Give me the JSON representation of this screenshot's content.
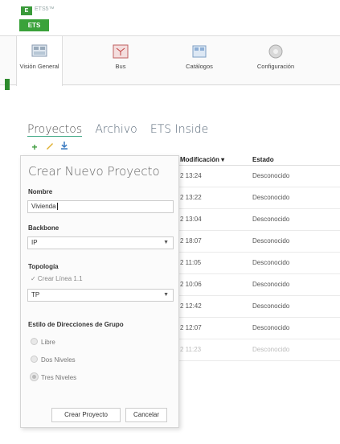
{
  "app": {
    "logo": "ETS",
    "subtitle": "ETS5™",
    "active_tab": "ETS"
  },
  "ribbon": [
    {
      "label": "Visión General",
      "icon": "overview-icon",
      "active": true
    },
    {
      "label": "Bus",
      "icon": "bus-icon",
      "active": false
    },
    {
      "label": "Catálogos",
      "icon": "catalog-icon",
      "active": false
    },
    {
      "label": "Configuración",
      "icon": "settings-gear-icon",
      "active": false
    }
  ],
  "tabs": [
    "Proyectos",
    "Archivo",
    "ETS Inside"
  ],
  "table": {
    "headers": [
      "Modificación ▾",
      "Estado"
    ],
    "rows": [
      {
        "mod": "2 13:24",
        "status": "Desconocido"
      },
      {
        "mod": "2 13:22",
        "status": "Desconocido"
      },
      {
        "mod": "2 13:04",
        "status": "Desconocido"
      },
      {
        "mod": "2 18:07",
        "status": "Desconocido"
      },
      {
        "mod": "2 11:05",
        "status": "Desconocido"
      },
      {
        "mod": "2 10:06",
        "status": "Desconocido"
      },
      {
        "mod": "2 12:42",
        "status": "Desconocido"
      },
      {
        "mod": "2 12:07",
        "status": "Desconocido"
      },
      {
        "mod": "2 11:23",
        "status": "Desconocido"
      }
    ]
  },
  "panel": {
    "title": "Crear Nuevo Proyecto",
    "name_label": "Nombre",
    "name_value": "Vivienda",
    "backbone_label": "Backbone",
    "backbone_value": "IP",
    "topology_label": "Topología",
    "create_lines": "✓ Crear Línea 1.1",
    "topology_value": "TP",
    "group_style_label": "Estilo de Direcciones de Grupo",
    "radio_options": [
      "Libre",
      "Dos Niveles",
      "Tres Niveles"
    ],
    "selected_option": "Tres Niveles",
    "create_button": "Crear Proyecto",
    "cancel_button": "Cancelar"
  },
  "colors": {
    "accent_green": "#3aa23a",
    "panel_bg": "#fbfbfb"
  }
}
